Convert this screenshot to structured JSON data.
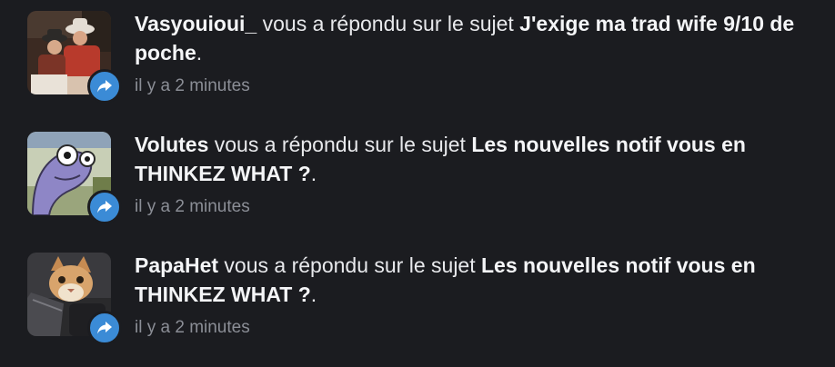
{
  "notifications": [
    {
      "user": "Vasyouioui_",
      "action": " vous a répondu sur le sujet ",
      "topic": "J'exige ma trad wife 9/10 de poche",
      "end": ".",
      "time": "il y a 2 minutes",
      "avatar_icon": "cowboy-photo-avatar",
      "badge_icon": "reply-arrow-icon"
    },
    {
      "user": "Volutes",
      "action": " vous a répondu sur le sujet ",
      "topic": "Les nouvelles notif vous en THINKEZ WHAT ?",
      "end": ".",
      "time": "il y a 2 minutes",
      "avatar_icon": "cartoon-fish-avatar",
      "badge_icon": "reply-arrow-icon"
    },
    {
      "user": "PapaHet",
      "action": " vous a répondu sur le sujet ",
      "topic": "Les nouvelles notif vous en THINKEZ WHAT ?",
      "end": ".",
      "time": "il y a 2 minutes",
      "avatar_icon": "cat-photo-avatar",
      "badge_icon": "reply-arrow-icon"
    }
  ],
  "colors": {
    "background": "#1b1c20",
    "text": "#e8e9ec",
    "muted": "#8b8e96",
    "badge": "#3b8bd6"
  }
}
